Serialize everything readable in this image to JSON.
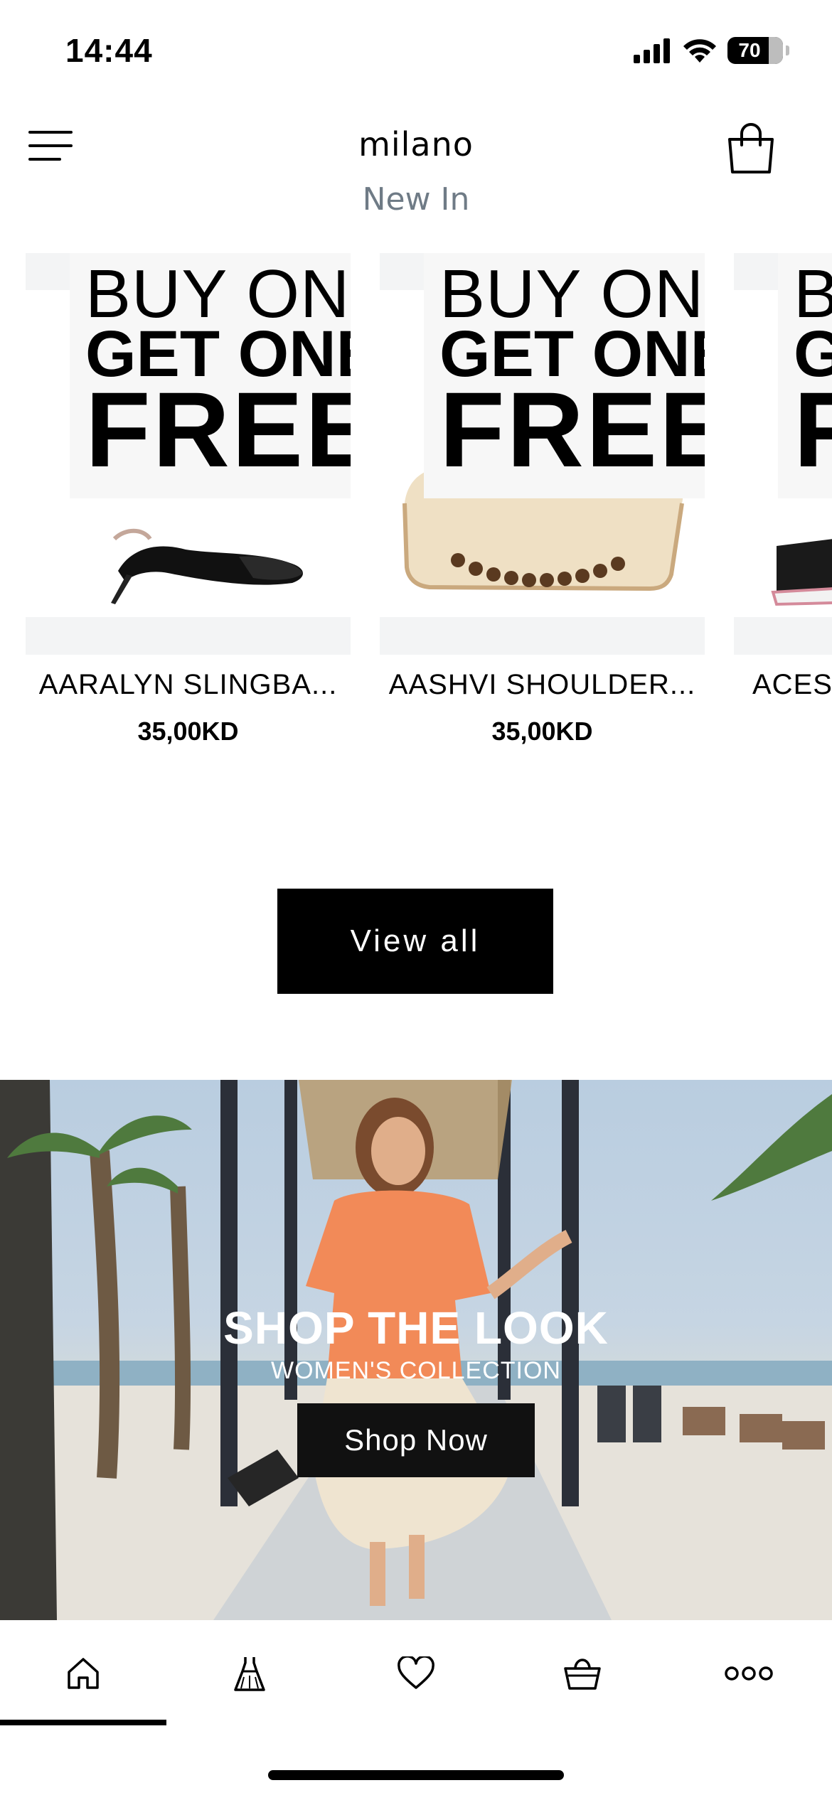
{
  "status_bar": {
    "time": "14:44",
    "battery": "70",
    "battery_level": 0.7
  },
  "header": {
    "logo": "milano",
    "icons": [
      "menu-icon",
      "shopping-bag-icon"
    ]
  },
  "section": {
    "title": "New In"
  },
  "products": [
    {
      "promo": [
        "BUY ONE",
        "GET ONE",
        "FREE"
      ],
      "name": "AARALYN SLINGBA...",
      "price": "35,00KD"
    },
    {
      "promo": [
        "BUY ONE",
        "GET ONE",
        "FREE"
      ],
      "name": "AASHVI SHOULDER...",
      "price": "35,00KD"
    },
    {
      "promo": [
        "BUY ONE",
        "GET ONE",
        "FREE"
      ],
      "name": "ACESP",
      "price": ""
    }
  ],
  "view_all": {
    "label": "View all"
  },
  "banner": {
    "title": "SHOP THE LOOK",
    "subtitle": "WOMEN'S COLLECTION",
    "cta": "Shop Now"
  },
  "tab_bar": {
    "tabs": [
      {
        "icon": "home-icon",
        "active": true
      },
      {
        "icon": "dress-icon",
        "active": false
      },
      {
        "icon": "heart-icon",
        "active": false
      },
      {
        "icon": "basket-icon",
        "active": false
      },
      {
        "icon": "more-icon",
        "active": false
      }
    ]
  }
}
